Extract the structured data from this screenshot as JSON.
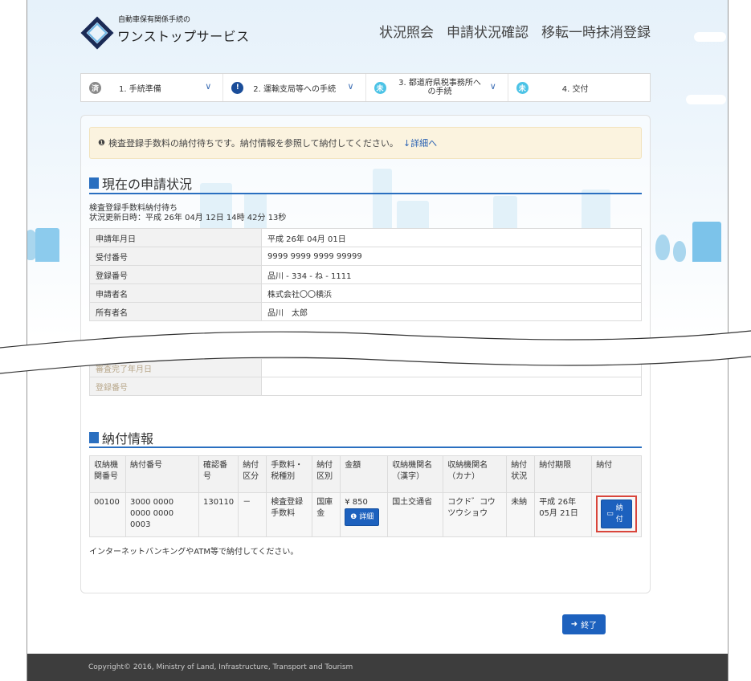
{
  "header": {
    "logo_small": "自動車保有関係手続の",
    "logo_big": "ワンストップサービス",
    "nav": [
      "状況照会",
      "申請状況確認",
      "移転一時抹消登録"
    ]
  },
  "steps": [
    {
      "badge": "済",
      "label": "1. 手続準備",
      "color": "#8a8a8a"
    },
    {
      "badge": "!",
      "label": "2. 運輸支局等への手続",
      "color": "#1a4d99"
    },
    {
      "badge": "未",
      "label": "3. 都道府県税事務所への手続",
      "color": "#4cc3e6"
    },
    {
      "badge": "未",
      "label": "4. 交付",
      "color": "#4cc3e6"
    }
  ],
  "alert": {
    "text": "検査登録手数料の納付待ちです。納付情報を参照して納付してください。",
    "link": "詳細へ"
  },
  "status_section": {
    "title": "現在の申請状況",
    "status": "検査登録手数料納付待ち",
    "updated": "状況更新日時：平成 26年 04月 12日 14時 42分 13秒",
    "rows": [
      {
        "k": "申請年月日",
        "v": "平成 26年 04月 01日"
      },
      {
        "k": "受付番号",
        "v": "9999 9999 9999 99999"
      },
      {
        "k": "登録番号",
        "v": "品川 - 334 - ね - 1111"
      },
      {
        "k": "申請者名",
        "v": "株式会社〇〇横浜"
      },
      {
        "k": "所有者名",
        "v": "品川　太郎"
      }
    ],
    "rows_after": [
      {
        "k": "審査完了年月日",
        "v": ""
      },
      {
        "k": "登録番号",
        "v": ""
      }
    ]
  },
  "payment_section": {
    "title": "納付情報",
    "headers": [
      "収納機関番号",
      "納付番号",
      "確認番号",
      "納付区分",
      "手数料・税種別",
      "納付区別",
      "金額",
      "収納機関名（漢字）",
      "収納機関名（カナ）",
      "納付状況",
      "納付期限",
      "納付"
    ],
    "row": {
      "org_no": "00100",
      "pay_no": "3000 0000 0000 0000 0003",
      "confirm_no": "130110",
      "pay_class": "－",
      "fee_type": "検査登録手数料",
      "pay_div": "国庫金",
      "amount": "¥ 850",
      "detail_btn": "詳細",
      "org_kanji": "国土交通省",
      "org_kana": "コクド゛コウツウショウ",
      "status": "未納",
      "deadline": "平成 26年 05月 21日",
      "pay_btn": "納付"
    },
    "note": "インターネットバンキングやATM等で納付してください。"
  },
  "exit_btn": "終了",
  "footer": "Copyright© 2016, Ministry of Land, Infrastructure, Transport and Tourism"
}
